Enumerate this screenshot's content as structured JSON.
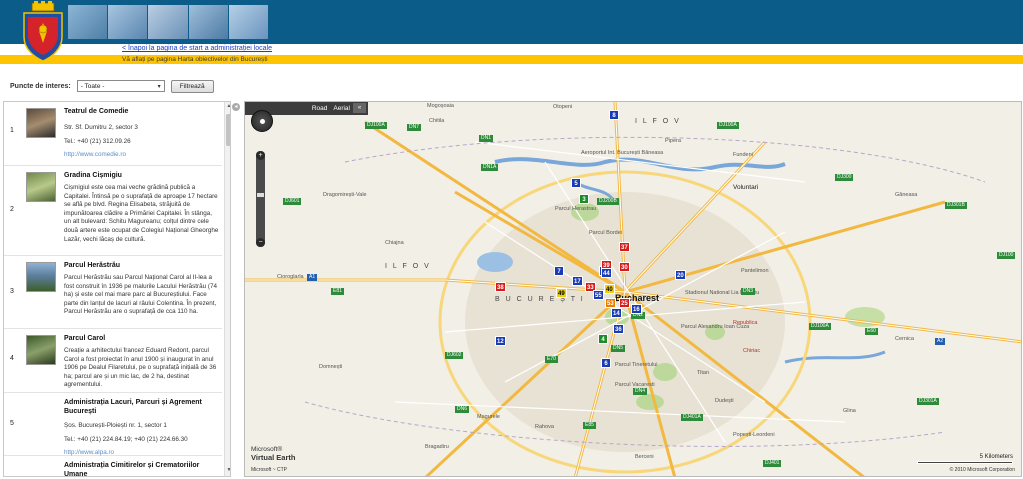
{
  "header": {
    "back_link": "< Înapoi la pagina de start a administrației locale",
    "current_page": "Vă aflați pe pagina Harta obiectivelor din București"
  },
  "filter": {
    "label": "Puncte de interes:",
    "selected": "- Toate -",
    "button": "Filtrează"
  },
  "list": [
    {
      "num": "1",
      "title": "Teatrul de Comedie",
      "lines": [
        "Str. Sf. Dumitru 2, sector 3",
        "Tel.: +40 (21) 312.09.26"
      ],
      "link": "http://www.comedie.ro"
    },
    {
      "num": "2",
      "title": "Gradina Cișmigiu",
      "text": "Cișmigiul este cea mai veche grădină publică a Capitalei. Întinsă pe o suprafață de aproape 17 hectare se află pe blvd. Regina Elisabeta, străjuită de impunătoarea clădire a Primăriei Capitalei. În stânga, un alt bulevard: Schitu Magureanu; colțul dintre cele două artere este ocupat de Colegiul Național Gheorghe Lazăr, vechi lăcaș de cultură."
    },
    {
      "num": "3",
      "title": "Parcul Herăstrău",
      "text": "Parcul Herăstrău sau Parcul Național Carol al II-lea a fost construit în 1936 pe malurile Lacului Herăstrău (74 ha) și este cel mai mare parc al Bucureștiului. Face parte din lanțul de lacuri al râului Colentina. În prezent, Parcul Herăstrău are o suprafață de cca 110 ha."
    },
    {
      "num": "4",
      "title": "Parcul Carol",
      "text": "Creație a arhitectului francez Eduard Redont, parcul Carol a fost proiectat în anul 1900 și inaugurat în anul 1906 pe Dealul Filaretului, pe o suprafață inițială de 36 ha; parcul are și un mic lac, de 2 ha, destinat agrementului."
    },
    {
      "num": "5",
      "title": "Administrația Lacuri, Parcuri și Agrement București",
      "lines": [
        "Șos. București-Ploiești nr. 1, sector 1",
        "Tel.: +40 (21) 224.84.19; +40 (21) 224.66.30"
      ],
      "link": "http://www.alpa.ro"
    },
    {
      "num": "6",
      "title": "Administrația Cimitirelor și Crematoriilor Umane"
    }
  ],
  "map": {
    "toolbar": {
      "road": "Road",
      "aerial": "Aerial",
      "collapse": "«"
    },
    "places": {
      "bucharest": "Bucharest",
      "ilfov_w": "I L F O V",
      "ilfov_e": "I L F O V",
      "bucuresti": "B U C U R E Ș T I",
      "voluntari": "Voluntari",
      "pipera": "Pipera",
      "chiajna": "Chiajna",
      "cioroglarla": "Cioroglarla",
      "dragomiresti": "Dragomirești-Vale",
      "domnesti": "Domnești",
      "magurele": "Magurele",
      "bragadiru": "Bragadiru",
      "popesti": "Popești-Leordeni",
      "glina": "Glina",
      "cernica": "Cernica",
      "pantelimon": "Pantelimon",
      "ganeasa": "Găneasa",
      "mogosoaia": "Mogoșoaia",
      "chitila": "Chitila",
      "otopeni": "Otopeni",
      "tunari": "Tunari",
      "fundeni": "Fundeni",
      "floreasca": "Floreasca",
      "titan": "Titan",
      "militari": "Militari",
      "berceni": "Berceni",
      "rahova": "Rahova",
      "ferentari": "Ferentari",
      "colentina": "Colentina",
      "vitan": "Vitan",
      "republica": "Republica",
      "chiriac": "Chiriac",
      "dudesti": "Dudești",
      "balotesti": "Balotești",
      "tineretului": "Parcul Tineretului",
      "alexandru_ioan_cuza": "Parcul Alexandru Ioan Cuza",
      "herastrau": "Parcul Herastrau",
      "bordei": "Parcul Bordei",
      "national_arena": "Stadionul National Lia Manoliu",
      "vacaresti": "Parcul Vacaresti",
      "aeroportul": "Aeroportul Int. București Băneasa"
    },
    "roads": {
      "a1": "A1",
      "a2": "A2",
      "e81": "E81",
      "e85": "E85",
      "e70": "E70",
      "e60": "E60",
      "dn7": "DN7",
      "dn1": "DN1",
      "dn1a": "DN1A",
      "dn2": "DN2",
      "dn3": "DN3",
      "dn4": "DN4",
      "dn5": "DN5",
      "dn6": "DN6",
      "dn5_b": "DN5",
      "dn100a": "DJ100A",
      "dj100a_e": "DJ100A",
      "dj200b": "DJ200B",
      "dj300": "DJ300",
      "dj301b": "DJ301B",
      "dj100": "DJ100",
      "dj301a": "DJ301A",
      "dj100a_s": "DJ100A",
      "dj601": "DJ601",
      "dj602": "DJ602",
      "dj401a": "DJ401A",
      "dj602_b": "DJ602",
      "dj401": "DJ401",
      "dc143": "DC143",
      "dj101": "DJ101",
      "dn65": "DN65",
      "dj200a": "DJ200A",
      "dj601_b": "DJ601"
    },
    "pins": [
      {
        "label": "8",
        "color": "blue"
      },
      {
        "label": "5",
        "color": "blue"
      },
      {
        "label": "3",
        "color": "green"
      },
      {
        "label": "37",
        "color": "red"
      },
      {
        "label": "20",
        "color": "blue"
      },
      {
        "label": "7",
        "color": "blue"
      },
      {
        "label": "17",
        "color": "blue"
      },
      {
        "label": "43",
        "color": "blue"
      },
      {
        "label": "39",
        "color": "red"
      },
      {
        "label": "30",
        "color": "red"
      },
      {
        "label": "38",
        "color": "red"
      },
      {
        "label": "33",
        "color": "red"
      },
      {
        "label": "40",
        "color": "yellow"
      },
      {
        "label": "49",
        "color": "yellow"
      },
      {
        "label": "55",
        "color": "blue"
      },
      {
        "label": "53",
        "color": "orange"
      },
      {
        "label": "25",
        "color": "red"
      },
      {
        "label": "14",
        "color": "blue"
      },
      {
        "label": "16",
        "color": "blue"
      },
      {
        "label": "36",
        "color": "blue"
      },
      {
        "label": "12",
        "color": "blue"
      },
      {
        "label": "4",
        "color": "green"
      },
      {
        "label": "6",
        "color": "blue"
      },
      {
        "label": "44",
        "color": "blue"
      }
    ],
    "brand": "Virtual Earth",
    "brand_prefix": "Microsoft®",
    "ctp": "Microsoft ~ CTP",
    "scale": "5 Kilometers",
    "copyright": "© 2010 Microsoft Corporation"
  },
  "icons": {
    "logo": "coat-of-arms",
    "compass": "compass-icon",
    "zoom_in": "zoom-in-icon",
    "zoom_out": "zoom-out-icon"
  }
}
